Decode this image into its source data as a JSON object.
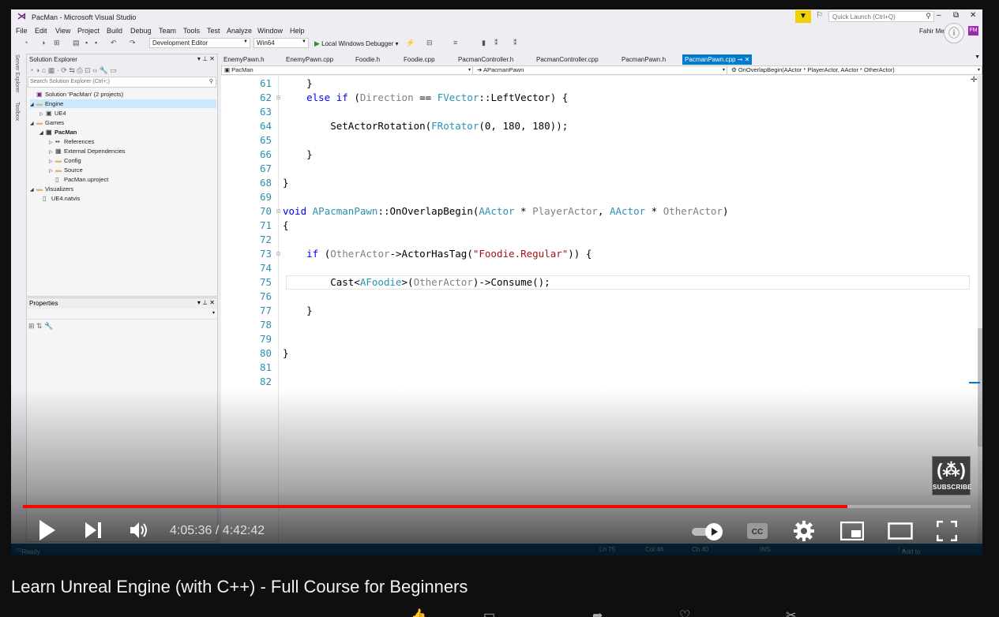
{
  "vs": {
    "title": "PacMan - Microsoft Visual Studio",
    "quick_launch_placeholder": "Quick Launch (Ctrl+Q)",
    "user_name": "Fahir Me",
    "user_initials": "FM",
    "menu": [
      "File",
      "Edit",
      "View",
      "Project",
      "Build",
      "Debug",
      "Team",
      "Tools",
      "Test",
      "Analyze",
      "Window",
      "Help"
    ],
    "toolbar": {
      "config": "Development Editor",
      "platform": "Win64",
      "debugger": "Local Windows Debugger"
    },
    "side_strip": [
      "Server Explorer",
      "Toolbox"
    ]
  },
  "solution_explorer": {
    "title": "Solution Explorer",
    "search_placeholder": "Search Solution Explorer (Ctrl+;)",
    "tree": [
      {
        "label": "Solution 'PacMan' (2 projects)",
        "icon": "solution-icon"
      },
      {
        "label": "Engine",
        "icon": "folder-icon"
      },
      {
        "label": "UE4",
        "icon": "project-icon"
      },
      {
        "label": "Games",
        "icon": "folder-icon"
      },
      {
        "label": "PacMan",
        "icon": "project-icon"
      },
      {
        "label": "References",
        "icon": "references-icon"
      },
      {
        "label": "External Dependencies",
        "icon": "dependencies-icon"
      },
      {
        "label": "Config",
        "icon": "folder-icon"
      },
      {
        "label": "Source",
        "icon": "folder-icon"
      },
      {
        "label": "PacMan.uproject",
        "icon": "file-icon"
      },
      {
        "label": "Visualizers",
        "icon": "folder-icon"
      },
      {
        "label": "UE4.natvis",
        "icon": "file-icon"
      }
    ]
  },
  "properties": {
    "title": "Properties"
  },
  "editor": {
    "tabs": [
      "EnemyPawn.h",
      "EnemyPawn.cpp",
      "Foodie.h",
      "Foodie.cpp",
      "PacmanController.h",
      "PacmanController.cpp",
      "PacmanPawn.h",
      "PacmanPawn.cpp"
    ],
    "active_tab": "PacmanPawn.cpp",
    "nav": {
      "project": "PacMan",
      "class": "APacmanPawn",
      "member": "OnOverlapBegin(AActor * PlayerActor, AActor * OtherActor)"
    },
    "line_numbers": [
      "61",
      "62",
      "63",
      "64",
      "65",
      "66",
      "67",
      "68",
      "69",
      "70",
      "71",
      "72",
      "73",
      "74",
      "75",
      "76",
      "77",
      "78",
      "79",
      "80",
      "81",
      "82"
    ]
  },
  "status_bar": {
    "state": "Ready",
    "ln": "Ln 75",
    "col": "Col 46",
    "ch": "Ch 40",
    "ins": "INS",
    "source_control": "Add to Source Control"
  },
  "player": {
    "current_time": "4:05:36",
    "separator": " / ",
    "duration": "4:42:42",
    "progress_fraction": 0.87,
    "subscribe_label": "SUBSCRIBE"
  },
  "video": {
    "title": "Learn Unreal Engine (with C++) - Full Course for Beginners"
  },
  "colors": {
    "accent_blue": "#007acc",
    "progress_red": "#ff0000",
    "status_blue": "#0e639c"
  }
}
